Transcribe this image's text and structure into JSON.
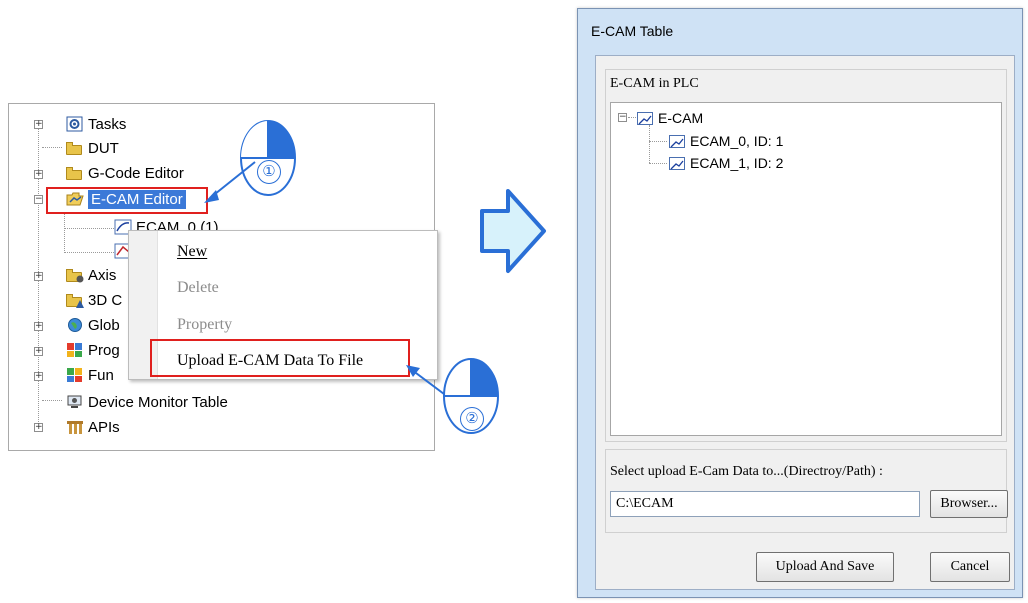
{
  "tree": {
    "items": [
      {
        "label": "Tasks"
      },
      {
        "label": "DUT"
      },
      {
        "label": "G-Code Editor"
      },
      {
        "label": "E-CAM Editor"
      },
      {
        "label": "ECAM_0 (1)"
      },
      {
        "label": "Axis"
      },
      {
        "label": "3D C"
      },
      {
        "label": "Glob"
      },
      {
        "label": "Prog"
      },
      {
        "label": "Fun"
      },
      {
        "label": "Device Monitor Table"
      },
      {
        "label": "APIs"
      }
    ]
  },
  "context_menu": {
    "items": [
      {
        "label": "New",
        "enabled": true
      },
      {
        "label": "Delete",
        "enabled": false
      },
      {
        "label": "Property",
        "enabled": false
      },
      {
        "label": "Upload E-CAM Data To File",
        "enabled": true
      }
    ]
  },
  "callouts": {
    "step1": "①",
    "step2": "②"
  },
  "dialog": {
    "title": "E-CAM Table",
    "group_title": "E-CAM in PLC",
    "plc_tree": {
      "root": "E-CAM",
      "children": [
        {
          "label": "ECAM_0, ID: 1"
        },
        {
          "label": "ECAM_1, ID: 2"
        }
      ]
    },
    "path_label": "Select upload E-Cam Data to...(Directroy/Path) :",
    "path_value": "C:\\ECAM",
    "browse_label": "Browser...",
    "upload_label": "Upload And Save",
    "cancel_label": "Cancel"
  },
  "colors": {
    "highlight_red": "#e0201e",
    "selection_blue": "#3b79d8",
    "arrow_blue": "#2a6fd6",
    "dialog_frame": "#cfe2f5"
  }
}
